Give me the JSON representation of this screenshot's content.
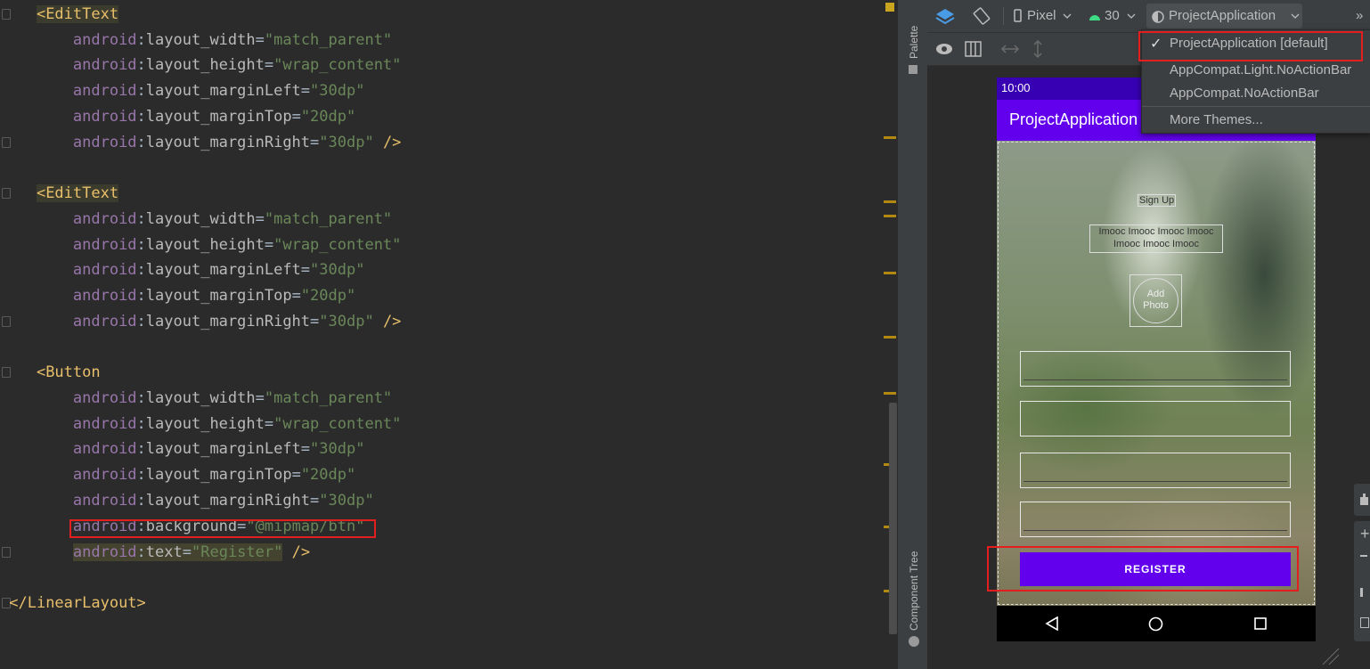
{
  "editor": {
    "lines": [
      {
        "open_tag": "<EditText"
      },
      {
        "ns": "android",
        "attr": "layout_width",
        "value": "\"match_parent\""
      },
      {
        "ns": "android",
        "attr": "layout_height",
        "value": "\"wrap_content\""
      },
      {
        "ns": "android",
        "attr": "layout_marginLeft",
        "value": "\"30dp\""
      },
      {
        "ns": "android",
        "attr": "layout_marginTop",
        "value": "\"20dp\""
      },
      {
        "ns": "android",
        "attr": "layout_marginRight",
        "value": "\"30dp\"",
        "close": " />"
      },
      {
        "open_tag": "<EditText"
      },
      {
        "ns": "android",
        "attr": "layout_width",
        "value": "\"match_parent\""
      },
      {
        "ns": "android",
        "attr": "layout_height",
        "value": "\"wrap_content\""
      },
      {
        "ns": "android",
        "attr": "layout_marginLeft",
        "value": "\"30dp\""
      },
      {
        "ns": "android",
        "attr": "layout_marginTop",
        "value": "\"20dp\""
      },
      {
        "ns": "android",
        "attr": "layout_marginRight",
        "value": "\"30dp\"",
        "close": " />"
      },
      {
        "open_tag": "<Button"
      },
      {
        "ns": "android",
        "attr": "layout_width",
        "value": "\"match_parent\""
      },
      {
        "ns": "android",
        "attr": "layout_height",
        "value": "\"wrap_content\""
      },
      {
        "ns": "android",
        "attr": "layout_marginLeft",
        "value": "\"30dp\""
      },
      {
        "ns": "android",
        "attr": "layout_marginTop",
        "value": "\"20dp\""
      },
      {
        "ns": "android",
        "attr": "layout_marginRight",
        "value": "\"30dp\""
      },
      {
        "ns": "android",
        "attr": "background",
        "value": "\"@mipmap/btn\""
      },
      {
        "ns": "android",
        "attr": "text",
        "value": "\"Register\"",
        "close": " />"
      },
      {
        "close_tag": "</LinearLayout>"
      }
    ],
    "colon": ":",
    "equals": "="
  },
  "side_panel": {
    "palette_label": "Palette",
    "component_tree_label": "Component Tree"
  },
  "toolbar": {
    "device": "Pixel",
    "api_level": "30",
    "theme": "ProjectApplication",
    "overflow": "»"
  },
  "theme_menu": {
    "items": [
      {
        "label": "ProjectApplication [default]",
        "checked": true
      },
      {
        "label": "AppCompat.Light.NoActionBar",
        "checked": false
      },
      {
        "label": "AppCompat.NoActionBar",
        "checked": false
      },
      {
        "label": "More Themes...",
        "checked": false
      }
    ],
    "check_mark": "✓"
  },
  "preview": {
    "time": "10:00",
    "app_title": "ProjectApplication",
    "sign_up": "Sign Up",
    "subtitle_line1": "Imooc Imooc Imooc Imooc",
    "subtitle_line2": "Imooc Imooc Imooc",
    "add_photo_line1": "Add",
    "add_photo_line2": "Photo",
    "register_button": "REGISTER"
  },
  "colors": {
    "status_bar": "#3700b3",
    "app_bar": "#6200ee",
    "button": "#6200ee",
    "highlight_box": "#e31e1e"
  }
}
